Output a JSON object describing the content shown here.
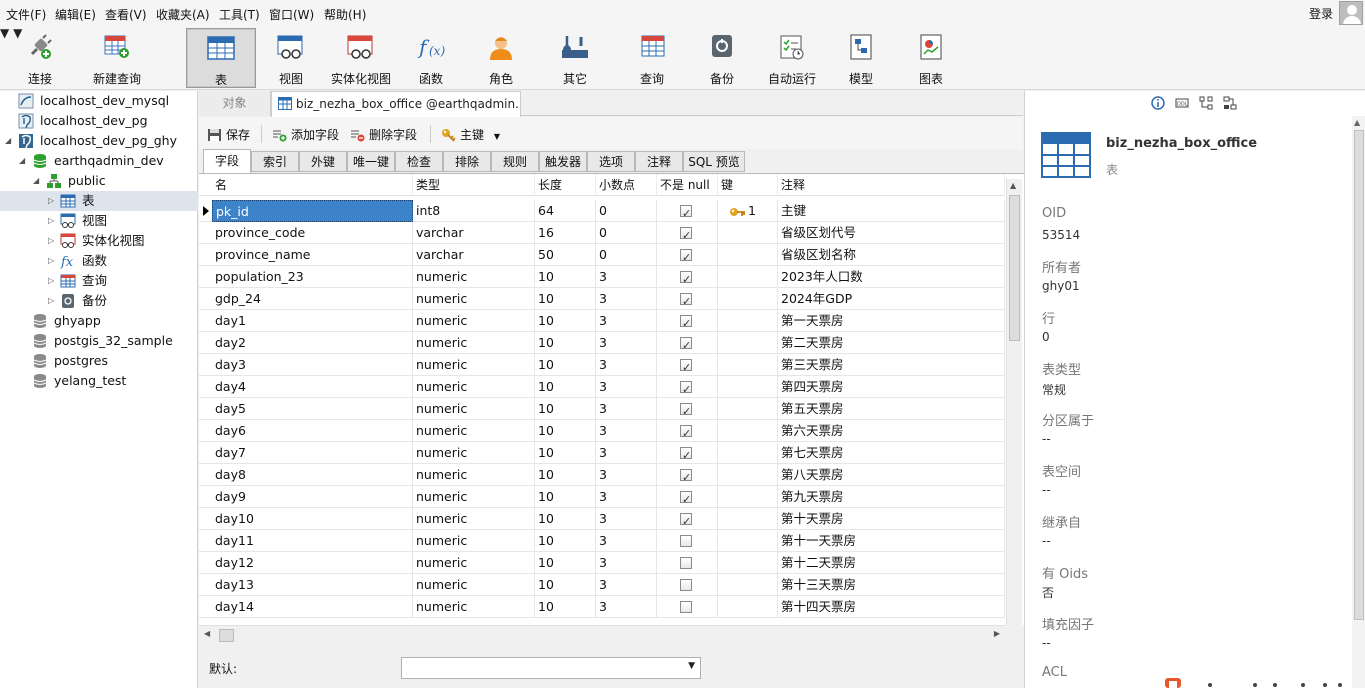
{
  "menu": [
    {
      "label": "文件(F)"
    },
    {
      "label": "编辑(E)"
    },
    {
      "label": "查看(V)"
    },
    {
      "label": "收藏夹(A)"
    },
    {
      "label": "工具(T)"
    },
    {
      "label": "窗口(W)"
    },
    {
      "label": "帮助(H)"
    }
  ],
  "login": "登录",
  "toolbar": {
    "connect": "连接",
    "new_query": "新建查询",
    "table": "表",
    "view": "视图",
    "mat_view": "实体化视图",
    "function": "函数",
    "role": "角色",
    "other": "其它",
    "query": "查询",
    "backup": "备份",
    "auto_run": "自动运行",
    "model": "模型",
    "chart": "图表"
  },
  "sidebar": {
    "items": [
      {
        "label": "localhost_dev_mysql"
      },
      {
        "label": "localhost_dev_pg"
      },
      {
        "label": "localhost_dev_pg_ghy"
      },
      {
        "label": "earthqadmin_dev"
      },
      {
        "label": "public"
      },
      {
        "label": "表"
      },
      {
        "label": "视图"
      },
      {
        "label": "实体化视图"
      },
      {
        "label": "函数"
      },
      {
        "label": "查询"
      },
      {
        "label": "备份"
      },
      {
        "label": "ghyapp"
      },
      {
        "label": "postgis_32_sample"
      },
      {
        "label": "postgres"
      },
      {
        "label": "yelang_test"
      }
    ]
  },
  "tabs": {
    "objects": "对象",
    "table_tab": "biz_nezha_box_office @earthqadmin..."
  },
  "edit_toolbar": {
    "save": "保存",
    "add_field": "添加字段",
    "delete_field": "删除字段",
    "primary_key": "主键"
  },
  "subtabs": [
    "字段",
    "索引",
    "外键",
    "唯一键",
    "检查",
    "排除",
    "规则",
    "触发器",
    "选项",
    "注释",
    "SQL 预览"
  ],
  "grid": {
    "headers": {
      "name": "名",
      "type": "类型",
      "length": "长度",
      "decimal": "小数点",
      "not_null": "不是 null",
      "key": "键",
      "comment": "注释"
    },
    "rows": [
      {
        "name": "pk_id",
        "type": "int8",
        "length": "64",
        "decimal": "0",
        "not_null": true,
        "key": "1",
        "comment": "主键"
      },
      {
        "name": "province_code",
        "type": "varchar",
        "length": "16",
        "decimal": "0",
        "not_null": true,
        "key": "",
        "comment": "省级区划代号"
      },
      {
        "name": "province_name",
        "type": "varchar",
        "length": "50",
        "decimal": "0",
        "not_null": true,
        "key": "",
        "comment": "省级区划名称"
      },
      {
        "name": "population_23",
        "type": "numeric",
        "length": "10",
        "decimal": "3",
        "not_null": true,
        "key": "",
        "comment": "2023年人口数"
      },
      {
        "name": "gdp_24",
        "type": "numeric",
        "length": "10",
        "decimal": "3",
        "not_null": true,
        "key": "",
        "comment": "2024年GDP"
      },
      {
        "name": "day1",
        "type": "numeric",
        "length": "10",
        "decimal": "3",
        "not_null": true,
        "key": "",
        "comment": "第一天票房"
      },
      {
        "name": "day2",
        "type": "numeric",
        "length": "10",
        "decimal": "3",
        "not_null": true,
        "key": "",
        "comment": "第二天票房"
      },
      {
        "name": "day3",
        "type": "numeric",
        "length": "10",
        "decimal": "3",
        "not_null": true,
        "key": "",
        "comment": "第三天票房"
      },
      {
        "name": "day4",
        "type": "numeric",
        "length": "10",
        "decimal": "3",
        "not_null": true,
        "key": "",
        "comment": "第四天票房"
      },
      {
        "name": "day5",
        "type": "numeric",
        "length": "10",
        "decimal": "3",
        "not_null": true,
        "key": "",
        "comment": "第五天票房"
      },
      {
        "name": "day6",
        "type": "numeric",
        "length": "10",
        "decimal": "3",
        "not_null": true,
        "key": "",
        "comment": "第六天票房"
      },
      {
        "name": "day7",
        "type": "numeric",
        "length": "10",
        "decimal": "3",
        "not_null": true,
        "key": "",
        "comment": "第七天票房"
      },
      {
        "name": "day8",
        "type": "numeric",
        "length": "10",
        "decimal": "3",
        "not_null": true,
        "key": "",
        "comment": "第八天票房"
      },
      {
        "name": "day9",
        "type": "numeric",
        "length": "10",
        "decimal": "3",
        "not_null": true,
        "key": "",
        "comment": "第九天票房"
      },
      {
        "name": "day10",
        "type": "numeric",
        "length": "10",
        "decimal": "3",
        "not_null": true,
        "key": "",
        "comment": "第十天票房"
      },
      {
        "name": "day11",
        "type": "numeric",
        "length": "10",
        "decimal": "3",
        "not_null": false,
        "key": "",
        "comment": "第十一天票房"
      },
      {
        "name": "day12",
        "type": "numeric",
        "length": "10",
        "decimal": "3",
        "not_null": false,
        "key": "",
        "comment": "第十二天票房"
      },
      {
        "name": "day13",
        "type": "numeric",
        "length": "10",
        "decimal": "3",
        "not_null": false,
        "key": "",
        "comment": "第十三天票房"
      },
      {
        "name": "day14",
        "type": "numeric",
        "length": "10",
        "decimal": "3",
        "not_null": false,
        "key": "",
        "comment": "第十四天票房"
      }
    ]
  },
  "default_label": "默认:",
  "info_panel": {
    "title": "biz_nezha_box_office",
    "subtitle": "表",
    "props": [
      {
        "label": "OID",
        "value": "53514"
      },
      {
        "label": "所有者",
        "value": "ghy01"
      },
      {
        "label": "行",
        "value": "0"
      },
      {
        "label": "表类型",
        "value": "常规"
      },
      {
        "label": "分区属于",
        "value": "--"
      },
      {
        "label": "表空间",
        "value": "--"
      },
      {
        "label": "继承自",
        "value": "--"
      },
      {
        "label": "有 Oids",
        "value": "否"
      },
      {
        "label": "填充因子",
        "value": "--"
      },
      {
        "label": "ACL",
        "value": ""
      }
    ]
  },
  "colors": {
    "accent": "#2b6cb0",
    "selection": "#3d83c9",
    "db_green": "#2e9e2e"
  }
}
